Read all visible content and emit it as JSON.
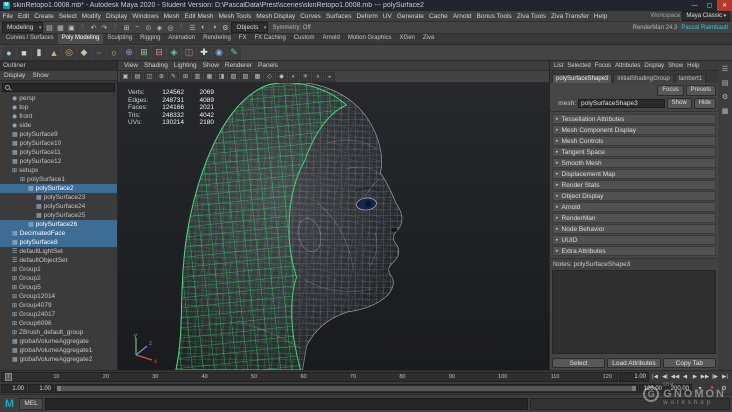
{
  "titlebar": {
    "title": "skinRetopo1.0008.mb* - Autodesk Maya 2020 - Student Version: D:\\PascalData\\Prest\\scenes\\skinRetopo1.0008.mb --- polySurface2",
    "badge": "M",
    "minimize": "—",
    "maximize": "▢",
    "close": "✕"
  },
  "menubar": {
    "items": [
      "File",
      "Edit",
      "Create",
      "Select",
      "Modify",
      "Display",
      "Windows",
      "Mesh",
      "Edit Mesh",
      "Mesh Tools",
      "Mesh Display",
      "Curves",
      "Surfaces",
      "Deform",
      "UV",
      "Generate",
      "Cache",
      "Arnold",
      "Bonus Tools",
      "Ziva Tools",
      "Ziva Transfer",
      "Help"
    ],
    "workspace_label": "Workspace",
    "workspace_value": "Maya Classic"
  },
  "statusline": {
    "mode": "Modeling",
    "mask": "Objects",
    "symmetry": "Symmetry: Off",
    "renderer": "RenderMan 24.3",
    "user": "Pascal Raimbault",
    "icons": [
      {
        "n": "new-scene-icon",
        "g": "▤"
      },
      {
        "n": "open-scene-icon",
        "g": "▦"
      },
      {
        "n": "save-scene-icon",
        "g": "▣"
      },
      {
        "n": "separator",
        "g": "‖"
      },
      {
        "n": "undo-icon",
        "g": "↶"
      },
      {
        "n": "redo-icon",
        "g": "↷"
      },
      {
        "n": "separator",
        "g": "‖"
      },
      {
        "n": "snap-grid-icon",
        "g": "⊞"
      },
      {
        "n": "snap-curve-icon",
        "g": "~"
      },
      {
        "n": "snap-point-icon",
        "g": "⊙"
      },
      {
        "n": "snap-plane-icon",
        "g": "◈"
      },
      {
        "n": "make-live-icon",
        "g": "◎"
      },
      {
        "n": "separator",
        "g": "‖"
      },
      {
        "n": "construction-history-icon",
        "g": "☰"
      },
      {
        "n": "render-icon",
        "g": "◐"
      },
      {
        "n": "ipr-render-icon",
        "g": "◑"
      },
      {
        "n": "render-settings-icon",
        "g": "⚙"
      }
    ]
  },
  "shelf": {
    "tabs": [
      {
        "t": "Curves / Surfaces",
        "cls": ""
      },
      {
        "t": "Poly Modeling",
        "cls": "active"
      },
      {
        "t": "Sculpting",
        "cls": ""
      },
      {
        "t": "Rigging",
        "cls": ""
      },
      {
        "t": "Animation",
        "cls": ""
      },
      {
        "t": "Rendering",
        "cls": ""
      },
      {
        "t": "FX",
        "cls": ""
      },
      {
        "t": "FX Caching",
        "cls": ""
      },
      {
        "t": "Custom",
        "cls": ""
      },
      {
        "t": "Arnold",
        "cls": ""
      },
      {
        "t": "Motion Graphics",
        "cls": ""
      },
      {
        "t": "XGen",
        "cls": ""
      },
      {
        "t": "Ziva",
        "cls": ""
      }
    ],
    "icons": [
      {
        "n": "shelf-sphere-icon",
        "g": "●",
        "s": "color:#8fd1ea"
      },
      {
        "n": "shelf-cube-icon",
        "g": "■",
        "s": "color:#cfcfcf"
      },
      {
        "n": "shelf-cylinder-icon",
        "g": "▮",
        "s": "color:#c9c9c9"
      },
      {
        "n": "shelf-cone-icon",
        "g": "▲",
        "s": "color:#cfae6a"
      },
      {
        "n": "shelf-torus-icon",
        "g": "◎",
        "s": "color:#d9a86c"
      },
      {
        "n": "shelf-plane-icon",
        "g": "◆",
        "s": "color:#b9c7a9"
      },
      {
        "n": "shelf-curve-icon",
        "g": "~",
        "s": "color:#e06a6a"
      },
      {
        "n": "shelf-circle-icon",
        "g": "○",
        "s": "color:#e0d06a"
      },
      {
        "n": "shelf-boolean-icon",
        "g": "⊕",
        "s": "color:#9a8fd0"
      },
      {
        "n": "shelf-combine-icon",
        "g": "⊞",
        "s": "color:#8fd19a"
      },
      {
        "n": "shelf-extrude-icon",
        "g": "⊟",
        "s": "color:#d08f9a"
      },
      {
        "n": "shelf-bevel-icon",
        "g": "◈",
        "s": "color:#6ac0b0"
      },
      {
        "n": "shelf-bridge-icon",
        "g": "◫",
        "s": "color:#c06ab0"
      },
      {
        "n": "shelf-multicut-icon",
        "g": "✚",
        "s": "color:#e0e0e0"
      },
      {
        "n": "shelf-target-weld-icon",
        "g": "◉",
        "s": "color:#7ab0e0"
      },
      {
        "n": "shelf-quad-draw-icon",
        "g": "✎",
        "s": "color:#57d684"
      }
    ]
  },
  "outliner": {
    "title": "Outliner",
    "menus": [
      "Display",
      "Show"
    ],
    "rows": [
      {
        "l": "persp",
        "i": "◉",
        "pad": "padding-left:12px"
      },
      {
        "l": "top",
        "i": "◉",
        "pad": "padding-left:12px"
      },
      {
        "l": "front",
        "i": "◉",
        "pad": "padding-left:12px"
      },
      {
        "l": "side",
        "i": "◉",
        "pad": "padding-left:12px"
      },
      {
        "l": "polySurface9",
        "i": "▦",
        "pad": "padding-left:12px"
      },
      {
        "l": "polySurface10",
        "i": "▦",
        "pad": "padding-left:12px"
      },
      {
        "l": "polySurface11",
        "i": "▦",
        "pad": "padding-left:12px"
      },
      {
        "l": "polySurface12",
        "i": "▦",
        "pad": "padding-left:12px"
      },
      {
        "l": "setups",
        "i": "⊞",
        "pad": "padding-left:12px"
      },
      {
        "l": "polySurface1",
        "i": "⊞",
        "pad": "padding-left:20px"
      },
      {
        "l": "polySurface2",
        "i": "▦",
        "pad": "padding-left:28px",
        "cls": "sel"
      },
      {
        "l": "polySurface23",
        "i": "▦",
        "pad": "padding-left:36px"
      },
      {
        "l": "polySurface24",
        "i": "▦",
        "pad": "padding-left:36px"
      },
      {
        "l": "polySurface25",
        "i": "▦",
        "pad": "padding-left:36px"
      },
      {
        "l": "polySurface26",
        "i": "▦",
        "pad": "padding-left:28px",
        "cls": "sel"
      },
      {
        "l": "DecimatedFace",
        "i": "▦",
        "pad": "padding-left:12px",
        "cls": "sel"
      },
      {
        "l": "polySurface8",
        "i": "▦",
        "pad": "padding-left:12px",
        "cls": "sel"
      },
      {
        "l": "defaultLightSet",
        "i": "☰",
        "pad": "padding-left:12px"
      },
      {
        "l": "defaultObjectSet",
        "i": "☰",
        "pad": "padding-left:12px"
      },
      {
        "l": "Group1",
        "i": "⊞",
        "pad": "padding-left:12px"
      },
      {
        "l": "Group2",
        "i": "⊞",
        "pad": "padding-left:12px"
      },
      {
        "l": "Group5",
        "i": "⊞",
        "pad": "padding-left:12px"
      },
      {
        "l": "Group12014",
        "i": "⊞",
        "pad": "padding-left:12px"
      },
      {
        "l": "Group4079",
        "i": "⊞",
        "pad": "padding-left:12px"
      },
      {
        "l": "Group24017",
        "i": "⊞",
        "pad": "padding-left:12px"
      },
      {
        "l": "Group6096",
        "i": "⊞",
        "pad": "padding-left:12px"
      },
      {
        "l": "ZBrush_default_group",
        "i": "⊞",
        "pad": "padding-left:12px"
      },
      {
        "l": "globalVolumeAggregate",
        "i": "▦",
        "pad": "padding-left:12px"
      },
      {
        "l": "globalVolumeAggregate1",
        "i": "▦",
        "pad": "padding-left:12px"
      },
      {
        "l": "globalVolumeAggregate2",
        "i": "▦",
        "pad": "padding-left:12px"
      }
    ]
  },
  "viewport": {
    "menus": [
      "View",
      "Shading",
      "Lighting",
      "Show",
      "Renderer",
      "Panels"
    ],
    "toolbar_icons": [
      {
        "n": "camera-attributes-icon",
        "g": "▣"
      },
      {
        "n": "bookmarks-icon",
        "g": "▤"
      },
      {
        "n": "image-plane-icon",
        "g": "◫"
      },
      {
        "n": "2d-pan-zoom-icon",
        "g": "⊕"
      },
      {
        "n": "grease-pencil-icon",
        "g": "✎"
      },
      {
        "n": "grid-toggle-icon",
        "g": "⊞"
      },
      {
        "n": "film-gate-icon",
        "g": "▥"
      },
      {
        "n": "resolution-gate-icon",
        "g": "▦"
      },
      {
        "n": "gate-mask-icon",
        "g": "◨"
      },
      {
        "n": "field-chart-icon",
        "g": "▧"
      },
      {
        "n": "safe-action-icon",
        "g": "▨"
      },
      {
        "n": "safe-title-icon",
        "g": "▩"
      },
      {
        "n": "wireframe-display-icon",
        "g": "◇"
      },
      {
        "n": "shaded-display-icon",
        "g": "◆"
      },
      {
        "n": "textured-display-icon",
        "g": "◐"
      },
      {
        "n": "use-all-lights-icon",
        "g": "☀"
      },
      {
        "n": "shadows-icon",
        "g": "◑"
      },
      {
        "n": "xray-display-icon",
        "g": "◒"
      }
    ],
    "hud": {
      "rows": [
        {
          "label": "Verts:",
          "a": "124562",
          "b": "2069"
        },
        {
          "label": "Edges:",
          "a": "248731",
          "b": "4089"
        },
        {
          "label": "Faces:",
          "a": "124166",
          "b": "2021"
        },
        {
          "label": "Tris:",
          "a": "248332",
          "b": "4042"
        },
        {
          "label": "UVs:",
          "a": "130214",
          "b": "2180"
        }
      ]
    },
    "axis": {
      "x": "x",
      "y": "y",
      "z": "z"
    }
  },
  "ae": {
    "menus": [
      "List",
      "Selected",
      "Focus",
      "Attributes",
      "Display",
      "Show",
      "Help"
    ],
    "tabs": [
      {
        "t": "polySurfaceShape3",
        "cls": "active"
      },
      {
        "t": "initialShadingGroup",
        "cls": ""
      },
      {
        "t": "lambert1",
        "cls": ""
      }
    ],
    "focus": "Focus",
    "presets": "Presets",
    "show": "Show",
    "hide": "Hide",
    "mesh_label": "mesh:",
    "mesh_value": "polySurfaceShape3",
    "sections": [
      "Tessellation Attributes",
      "Mesh Component Display",
      "Mesh Controls",
      "Tangent Space",
      "Smooth Mesh",
      "Displacement Map",
      "Render Stats",
      "Object Display",
      "Arnold",
      "RenderMan",
      "Node Behavior",
      "UUID",
      "Extra Attributes"
    ],
    "notes_label": "Notes: polySurfaceShape3",
    "buttons": [
      "Select",
      "Load Attributes",
      "Copy Tab"
    ]
  },
  "right_strip": {
    "icons": [
      {
        "n": "channel-box-tab-icon",
        "g": "☰"
      },
      {
        "n": "attribute-editor-tab-icon",
        "g": "▤"
      },
      {
        "n": "tool-settings-tab-icon",
        "g": "⚙"
      },
      {
        "n": "modeling-toolkit-tab-icon",
        "g": "▦"
      }
    ]
  },
  "timeline": {
    "ticks": [
      "1",
      "10",
      "20",
      "30",
      "40",
      "50",
      "60",
      "70",
      "80",
      "90",
      "100",
      "110",
      "120"
    ],
    "current": "1.00",
    "playback": [
      {
        "n": "go-to-start-icon",
        "g": "|◀"
      },
      {
        "n": "step-back-frame-icon",
        "g": "◀|"
      },
      {
        "n": "step-back-key-icon",
        "g": "◀◀"
      },
      {
        "n": "play-backwards-icon",
        "g": "◀"
      },
      {
        "n": "play-forwards-icon",
        "g": "▶"
      },
      {
        "n": "step-fwd-key-icon",
        "g": "▶▶"
      },
      {
        "n": "step-fwd-frame-icon",
        "g": "|▶"
      },
      {
        "n": "go-to-end-icon",
        "g": "▶|"
      }
    ]
  },
  "range": {
    "anim_start": "1.00",
    "play_start": "1.00",
    "play_end": "120.00",
    "anim_end": "200.00",
    "icons": [
      {
        "n": "character-set-icon",
        "g": "▾",
        "s": ""
      },
      {
        "n": "auto-key-icon",
        "g": "●",
        "s": "color:#cc4b4b"
      },
      {
        "n": "anim-preferences-icon",
        "g": "⚙",
        "s": ""
      }
    ]
  },
  "command_line": {
    "label": "MEL"
  },
  "watermark": {
    "the": "the",
    "main": "GNOMON",
    "sub": "workshop",
    "logo": "G"
  }
}
